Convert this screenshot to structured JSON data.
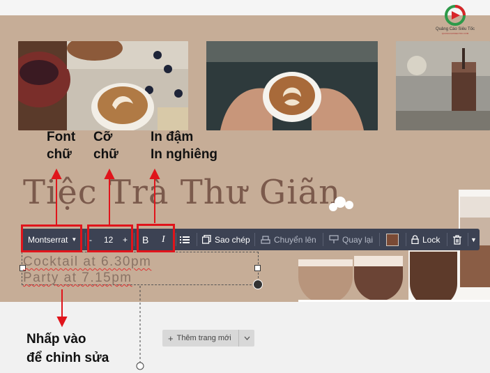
{
  "brand": {
    "name": "Quảng Cáo Siêu Tốc",
    "tagline": "QUANGCAOSIEUTOC.COM"
  },
  "canvas": {
    "title": "Tiệc Trà Thư Giãn",
    "description_lines": [
      "Cocktail at 6.30pm",
      "Party at 7.15pm"
    ]
  },
  "annotations": {
    "font": [
      "Font",
      "chữ"
    ],
    "size": [
      "Cỡ",
      "chữ"
    ],
    "style": [
      "In đậm",
      "In nghiêng"
    ],
    "click_to_edit": [
      "Nhấp vào",
      "để chỉnh sửa"
    ]
  },
  "toolbar": {
    "font_family": "Montserrat",
    "font_size": "12",
    "minus": "-",
    "plus": "+",
    "bold": "B",
    "italic": "I",
    "copy": "Sao chép",
    "move_up": "Chuyển lên",
    "undo": "Quay lại",
    "lock": "Lock",
    "text_color": "#7a4a35"
  },
  "add_page": {
    "label": "Thêm trang mới",
    "icon": "+"
  },
  "colors": {
    "canvas_bg": "#c6ad97",
    "toolbar_bg": "#3c4253",
    "annotation_red": "#e0141b",
    "title": "#7b5a4c"
  }
}
